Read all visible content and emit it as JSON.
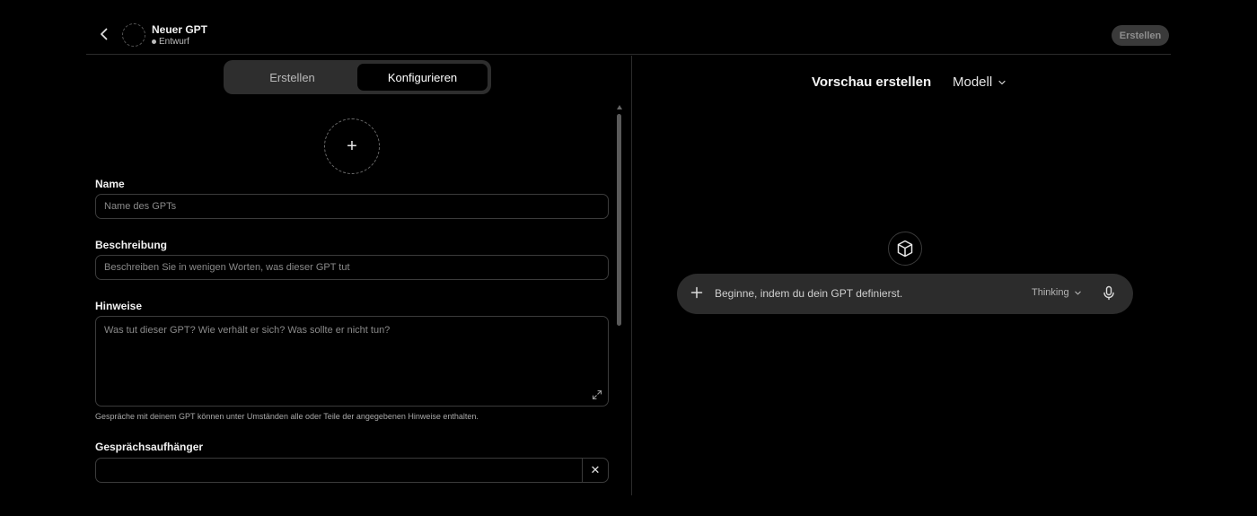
{
  "header": {
    "title": "Neuer GPT",
    "status": "Entwurf",
    "create_button": "Erstellen"
  },
  "tabs": [
    {
      "label": "Erstellen",
      "active": false
    },
    {
      "label": "Konfigurieren",
      "active": true
    }
  ],
  "form": {
    "avatar_plus": "+",
    "name": {
      "label": "Name",
      "placeholder": "Name des GPTs",
      "value": ""
    },
    "description": {
      "label": "Beschreibung",
      "placeholder": "Beschreiben Sie in wenigen Worten, was dieser GPT tut",
      "value": ""
    },
    "instructions": {
      "label": "Hinweise",
      "placeholder": "Was tut dieser GPT? Wie verhält er sich? Was sollte er nicht tun?",
      "value": "",
      "hint": "Gespräche mit deinem GPT können unter Umständen alle oder Teile der angegebenen Hinweise enthalten."
    },
    "conversation_starters": {
      "label": "Gesprächsaufhänger",
      "value": "",
      "remove_symbol": "✕"
    }
  },
  "preview": {
    "title": "Vorschau erstellen",
    "model_label": "Modell",
    "composer_placeholder": "Beginne, indem du dein GPT definierst.",
    "thinking_label": "Thinking"
  },
  "colors": {
    "background": "#000000",
    "surface": "#2c2c2c",
    "border": "#3b3b3b",
    "text_primary": "#ececec",
    "text_muted": "#8a8a8a"
  }
}
